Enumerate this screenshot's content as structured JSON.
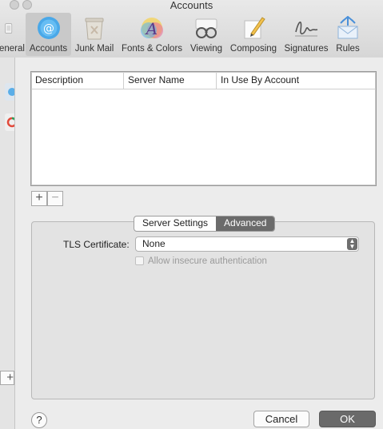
{
  "window": {
    "title": "Accounts"
  },
  "toolbar": {
    "items": [
      {
        "label": "eneral",
        "icon": "general-switch-icon",
        "active": false
      },
      {
        "label": "Accounts",
        "icon": "at-sign-icon",
        "active": true
      },
      {
        "label": "Junk Mail",
        "icon": "junk-bin-icon",
        "active": false
      },
      {
        "label": "Fonts & Colors",
        "icon": "fonts-colors-icon",
        "active": false
      },
      {
        "label": "Viewing",
        "icon": "glasses-icon",
        "active": false
      },
      {
        "label": "Composing",
        "icon": "pencil-paper-icon",
        "active": false
      },
      {
        "label": "Signatures",
        "icon": "signature-icon",
        "active": false
      },
      {
        "label": "Rules",
        "icon": "rules-envelope-icon",
        "active": false
      }
    ]
  },
  "accounts_table": {
    "columns": [
      "Description",
      "Server Name",
      "In Use By Account"
    ],
    "rows": []
  },
  "table_controls": {
    "add": "+",
    "remove": "−"
  },
  "tabs": {
    "server_settings": "Server Settings",
    "advanced": "Advanced",
    "selected": "Advanced"
  },
  "advanced": {
    "tls_label": "TLS Certificate:",
    "tls_value": "None",
    "allow_insecure_label": "Allow insecure authentication",
    "allow_insecure_checked": false
  },
  "buttons": {
    "help": "?",
    "cancel": "Cancel",
    "ok": "OK"
  },
  "colors": {
    "accent": "#6b6b6b",
    "active_icon": "#4aa8e8"
  }
}
